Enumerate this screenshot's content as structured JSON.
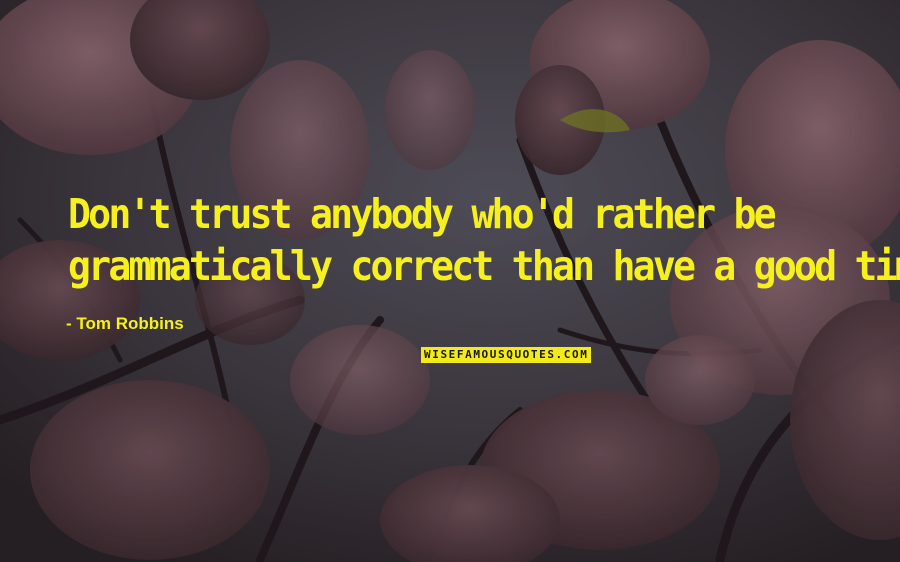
{
  "quote": {
    "line1": "Don't trust anybody who'd rather be",
    "line2": "grammatically correct than have a good time."
  },
  "author": "- Tom Robbins",
  "watermark": "WISEFAMOUSQUOTES.COM",
  "colors": {
    "text": "#f5f01e",
    "logo_bg": "#f2ea1a",
    "sky": "#5b5b6b",
    "blossom": "#a0707c"
  },
  "background": "pink magnolia blossoms on dark branches against a dusky sky"
}
